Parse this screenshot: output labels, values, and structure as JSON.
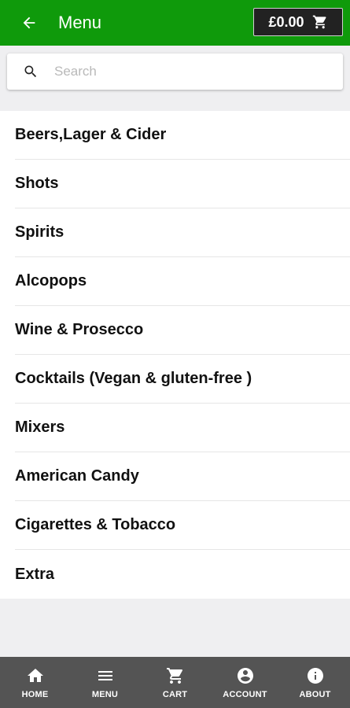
{
  "header": {
    "title": "Menu",
    "cart_total": "£0.00",
    "bar_color": "#0f9a0b"
  },
  "search": {
    "placeholder": "Search",
    "value": ""
  },
  "menu": {
    "items": [
      {
        "label": "Beers,Lager & Cider"
      },
      {
        "label": "Shots"
      },
      {
        "label": "Spirits"
      },
      {
        "label": "Alcopops"
      },
      {
        "label": "Wine & Prosecco"
      },
      {
        "label": "Cocktails (Vegan & gluten-free )"
      },
      {
        "label": "Mixers"
      },
      {
        "label": "American Candy"
      },
      {
        "label": "Cigarettes & Tobacco"
      },
      {
        "label": "Extra"
      }
    ]
  },
  "bottom_nav": {
    "items": [
      {
        "label": "HOME",
        "icon": "home-icon"
      },
      {
        "label": "MENU",
        "icon": "menu-icon"
      },
      {
        "label": "CART",
        "icon": "cart-icon"
      },
      {
        "label": "ACCOUNT",
        "icon": "account-icon"
      },
      {
        "label": "ABOUT",
        "icon": "info-icon"
      }
    ]
  }
}
